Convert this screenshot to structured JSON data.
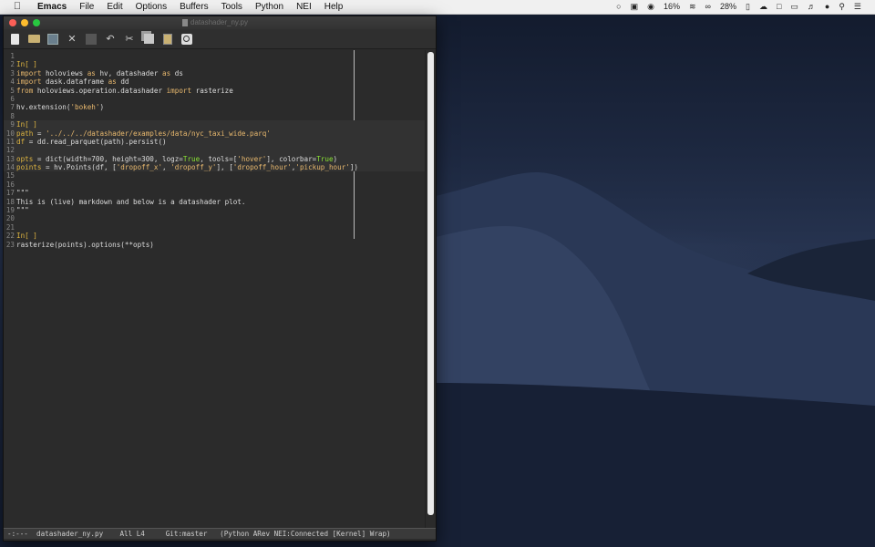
{
  "menubar": {
    "apple": "",
    "items": [
      "Emacs",
      "File",
      "Edit",
      "Options",
      "Buffers",
      "Tools",
      "Python",
      "NEI",
      "Help"
    ],
    "battery_a": "16%",
    "battery_b": "28%"
  },
  "window": {
    "title": "datashader_ny.py"
  },
  "editor": {
    "lines": [
      {
        "n": "1",
        "parts": [
          {
            "t": "",
            "c": ""
          }
        ]
      },
      {
        "n": "2",
        "parts": [
          {
            "t": "In[ ]",
            "c": "cellm"
          }
        ]
      },
      {
        "n": "3",
        "parts": [
          {
            "t": "import",
            "c": "kw"
          },
          {
            "t": " holoviews ",
            "c": ""
          },
          {
            "t": "as",
            "c": "kw"
          },
          {
            "t": " hv, datashader ",
            "c": ""
          },
          {
            "t": "as",
            "c": "kw"
          },
          {
            "t": " ds",
            "c": ""
          }
        ]
      },
      {
        "n": "4",
        "parts": [
          {
            "t": "import",
            "c": "kw"
          },
          {
            "t": " dask.dataframe ",
            "c": ""
          },
          {
            "t": "as",
            "c": "kw"
          },
          {
            "t": " dd",
            "c": ""
          }
        ]
      },
      {
        "n": "5",
        "parts": [
          {
            "t": "from",
            "c": "kw"
          },
          {
            "t": " holoviews.operation.datashader ",
            "c": ""
          },
          {
            "t": "import",
            "c": "kw"
          },
          {
            "t": " rasterize",
            "c": ""
          }
        ]
      },
      {
        "n": "6",
        "parts": [
          {
            "t": "",
            "c": ""
          }
        ]
      },
      {
        "n": "7",
        "parts": [
          {
            "t": "hv.extension(",
            "c": ""
          },
          {
            "t": "'bokeh'",
            "c": "str"
          },
          {
            "t": ")",
            "c": ""
          }
        ]
      },
      {
        "n": "8",
        "parts": [
          {
            "t": "",
            "c": ""
          }
        ]
      },
      {
        "n": "9",
        "parts": [
          {
            "t": "In[ ]",
            "c": "cellm"
          }
        ],
        "hl": true
      },
      {
        "n": "10",
        "parts": [
          {
            "t": "path",
            "c": "cellm"
          },
          {
            "t": " = ",
            "c": ""
          },
          {
            "t": "'../../../datashader/examples/data/nyc_taxi_wide.parq'",
            "c": "str"
          }
        ],
        "hl": true
      },
      {
        "n": "11",
        "parts": [
          {
            "t": "df",
            "c": "cellm"
          },
          {
            "t": " = dd.read_parquet(path).persist()",
            "c": ""
          }
        ],
        "hl": true
      },
      {
        "n": "12",
        "parts": [
          {
            "t": "",
            "c": ""
          }
        ],
        "hl": true
      },
      {
        "n": "13",
        "parts": [
          {
            "t": "opts",
            "c": "cellm"
          },
          {
            "t": " = dict(width=700, height=300, logz=",
            "c": ""
          },
          {
            "t": "True",
            "c": "bool"
          },
          {
            "t": ", tools=[",
            "c": ""
          },
          {
            "t": "'hover'",
            "c": "str"
          },
          {
            "t": "], colorbar=",
            "c": ""
          },
          {
            "t": "True",
            "c": "bool"
          },
          {
            "t": ")",
            "c": ""
          }
        ],
        "hl": true
      },
      {
        "n": "14",
        "parts": [
          {
            "t": "points",
            "c": "cellm"
          },
          {
            "t": " = hv.Points(df, [",
            "c": ""
          },
          {
            "t": "'dropoff_x'",
            "c": "str"
          },
          {
            "t": ", ",
            "c": ""
          },
          {
            "t": "'dropoff_y'",
            "c": "str"
          },
          {
            "t": "], [",
            "c": ""
          },
          {
            "t": "'dropoff_hour'",
            "c": "str"
          },
          {
            "t": ",",
            "c": ""
          },
          {
            "t": "'pickup_hour'",
            "c": "str"
          },
          {
            "t": "])",
            "c": ""
          }
        ],
        "hl": true
      },
      {
        "n": "15",
        "parts": [
          {
            "t": "",
            "c": ""
          }
        ]
      },
      {
        "n": "16",
        "parts": [
          {
            "t": "",
            "c": ""
          }
        ]
      },
      {
        "n": "17",
        "parts": [
          {
            "t": "\"\"\"",
            "c": ""
          }
        ]
      },
      {
        "n": "18",
        "parts": [
          {
            "t": "This is (live) markdown and below is a datashader plot.",
            "c": ""
          }
        ]
      },
      {
        "n": "19",
        "parts": [
          {
            "t": "\"\"\"",
            "c": ""
          }
        ]
      },
      {
        "n": "20",
        "parts": [
          {
            "t": "",
            "c": ""
          }
        ]
      },
      {
        "n": "21",
        "parts": [
          {
            "t": "",
            "c": ""
          }
        ]
      },
      {
        "n": "22",
        "parts": [
          {
            "t": "In[ ]",
            "c": "cellm"
          }
        ]
      },
      {
        "n": "23",
        "parts": [
          {
            "t": "rasterize(points).options(**opts)",
            "c": ""
          }
        ]
      }
    ]
  },
  "modeline": {
    "text": "-:---  datashader_ny.py    All L4     Git:master   (Python ARev NEI:Connected [Kernel] Wrap)"
  },
  "colors": {
    "keyword": "#e9b96e",
    "cell_marker": "#e0b640",
    "boolean": "#8ae234"
  }
}
